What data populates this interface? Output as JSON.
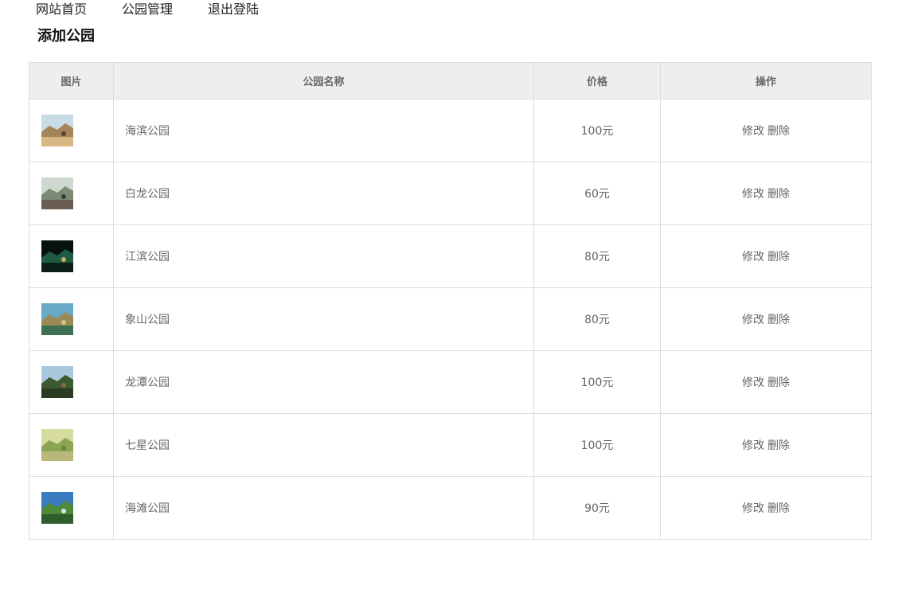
{
  "nav": {
    "items": [
      {
        "label": "网站首页",
        "name": "nav-home-link"
      },
      {
        "label": "公园管理",
        "name": "nav-park-management-link"
      },
      {
        "label": "退出登陆",
        "name": "nav-logout-link"
      }
    ]
  },
  "add_park_label": "添加公园",
  "table": {
    "headers": {
      "image": "图片",
      "name": "公园名称",
      "price": "价格",
      "ops": "操作"
    },
    "rows": [
      {
        "name": "海滨公园",
        "price": "100元",
        "edit": "修改",
        "delete": "删除",
        "thumb": "beach"
      },
      {
        "name": "白龙公园",
        "price": "60元",
        "edit": "修改",
        "delete": "删除",
        "thumb": "pavilion"
      },
      {
        "name": "江滨公园",
        "price": "80元",
        "edit": "修改",
        "delete": "删除",
        "thumb": "night"
      },
      {
        "name": "象山公园",
        "price": "80元",
        "edit": "修改",
        "delete": "删除",
        "thumb": "hill"
      },
      {
        "name": "龙潭公园",
        "price": "100元",
        "edit": "修改",
        "delete": "删除",
        "thumb": "forest"
      },
      {
        "name": "七星公园",
        "price": "100元",
        "edit": "修改",
        "delete": "删除",
        "thumb": "meadow"
      },
      {
        "name": "海滩公园",
        "price": "90元",
        "edit": "修改",
        "delete": "删除",
        "thumb": "coast"
      }
    ]
  },
  "thumbs": {
    "beach": {
      "sky": "#c9dbe6",
      "mid": "#a5845c",
      "ground": "#d8b784",
      "accent": "#5a4030"
    },
    "pavilion": {
      "sky": "#cfd8cf",
      "mid": "#7b8a72",
      "ground": "#6c5d52",
      "accent": "#3d3a36"
    },
    "night": {
      "sky": "#07120e",
      "mid": "#1f5a42",
      "ground": "#0b1f18",
      "accent": "#c8b060"
    },
    "hill": {
      "sky": "#6aa9c7",
      "mid": "#9a8b56",
      "ground": "#3f6f52",
      "accent": "#d2c48a"
    },
    "forest": {
      "sky": "#a9c8de",
      "mid": "#3c5a30",
      "ground": "#2b3a22",
      "accent": "#8a6a3a"
    },
    "meadow": {
      "sky": "#d6dca0",
      "mid": "#8aa450",
      "ground": "#b9b87a",
      "accent": "#6f7f3a"
    },
    "coast": {
      "sky": "#3a7cc0",
      "mid": "#4d8a3a",
      "ground": "#2e5f2a",
      "accent": "#d9e6ef"
    }
  }
}
